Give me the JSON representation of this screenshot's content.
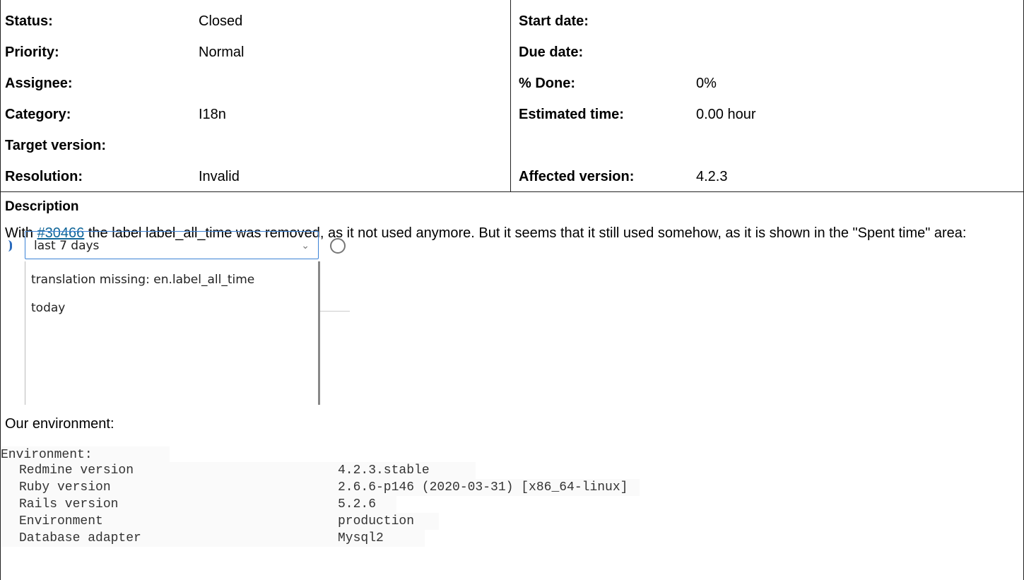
{
  "attributes": {
    "left": [
      {
        "label": "Status:",
        "value": "Closed"
      },
      {
        "label": "Priority:",
        "value": "Normal"
      },
      {
        "label": "Assignee:",
        "value": ""
      },
      {
        "label": "Category:",
        "value": "I18n"
      },
      {
        "label": "Target version:",
        "value": ""
      },
      {
        "label": "Resolution:",
        "value": "Invalid"
      }
    ],
    "right": [
      {
        "label": "Start date:",
        "value": ""
      },
      {
        "label": "Due date:",
        "value": ""
      },
      {
        "label": "% Done:",
        "value": "0%"
      },
      {
        "label": "Estimated time:",
        "value": "0.00 hour"
      },
      {
        "label": "Affected version:",
        "value": "4.2.3"
      }
    ]
  },
  "description": {
    "title": "Description",
    "text_before_link": "With ",
    "link_text": "#30466",
    "text_after_link": " the label label_all_time was removed, as it not used anymore. But it seems that it still used somehow, as it is shown in the \"Spent time\" area:"
  },
  "screenshot": {
    "selected": "last 7 days",
    "options": [
      "translation missing: en.label_all_time",
      "today"
    ]
  },
  "environment": {
    "intro": "Our environment:",
    "heading": "Environment:",
    "rows": [
      {
        "key": "Redmine version",
        "value": "4.2.3.stable"
      },
      {
        "key": "Ruby version",
        "value": "2.6.6-p146 (2020-03-31) [x86_64-linux]"
      },
      {
        "key": "Rails version",
        "value": "5.2.6"
      },
      {
        "key": "Environment",
        "value": "production"
      },
      {
        "key": "Database adapter",
        "value": "Mysql2"
      }
    ]
  }
}
